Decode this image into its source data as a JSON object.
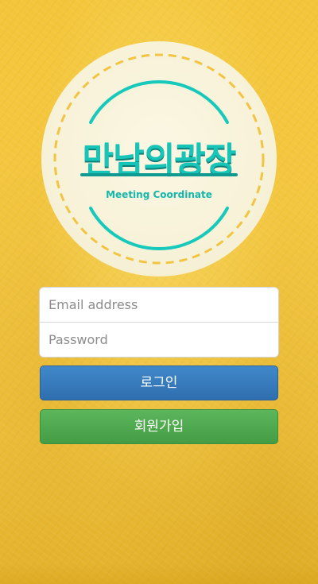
{
  "logo": {
    "title": "만남의광장",
    "subtitle": "Meeting Coordinate"
  },
  "login_form": {
    "email_placeholder": "Email address",
    "password_placeholder": "Password",
    "login_label": "로그인",
    "signup_label": "회원가입"
  },
  "colors": {
    "background": "#f4c741",
    "logo_teal": "#17c4b8",
    "login_button": "#337ab7",
    "signup_button": "#4fae4f"
  }
}
